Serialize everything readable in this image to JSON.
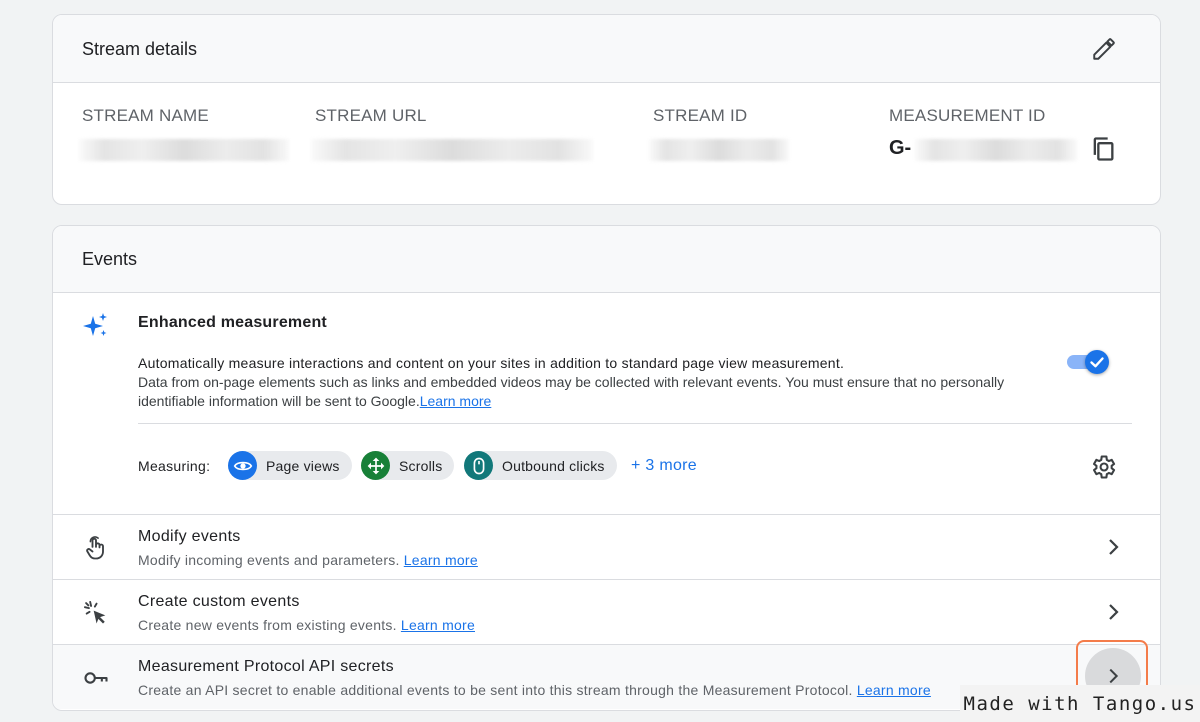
{
  "stream_details": {
    "title": "Stream details",
    "fields": [
      {
        "label": "STREAM NAME",
        "value": ""
      },
      {
        "label": "STREAM URL",
        "value": ""
      },
      {
        "label": "STREAM ID",
        "value": ""
      },
      {
        "label": "MEASUREMENT ID",
        "value": "G-"
      }
    ]
  },
  "events": {
    "title": "Events",
    "enhanced_measurement": {
      "title": "Enhanced measurement",
      "description_line1": "Automatically measure interactions and content on your sites in addition to standard page view measurement.",
      "description_line2": "Data from on-page elements such as links and embedded videos may be collected with relevant events. You must ensure that no personally identifiable information will be sent to Google.",
      "learn_more": "Learn more",
      "enabled": true,
      "measuring_label": "Measuring:",
      "chips": [
        {
          "label": "Page views",
          "icon": "eye-icon",
          "color": "#1a73e8"
        },
        {
          "label": "Scrolls",
          "icon": "scroll-arrows-icon",
          "color": "#188038"
        },
        {
          "label": "Outbound clicks",
          "icon": "mouse-icon",
          "color": "#12787a"
        }
      ],
      "more": "+ 3 more"
    },
    "rows": [
      {
        "title": "Modify events",
        "subtitle": "Modify incoming events and parameters.",
        "link": "Learn more",
        "icon": "touch-hand-icon"
      },
      {
        "title": "Create custom events",
        "subtitle": "Create new events from existing events.",
        "link": "Learn more",
        "icon": "click-sparkle-icon"
      },
      {
        "title": "Measurement Protocol API secrets",
        "subtitle": "Create an API secret to enable additional events to be sent into this stream through the Measurement Protocol.",
        "link": "Learn more",
        "icon": "key-icon"
      }
    ]
  },
  "watermark": "Made with Tango.us",
  "colors": {
    "accent": "#1a73e8",
    "highlight": "#f47c4a"
  }
}
